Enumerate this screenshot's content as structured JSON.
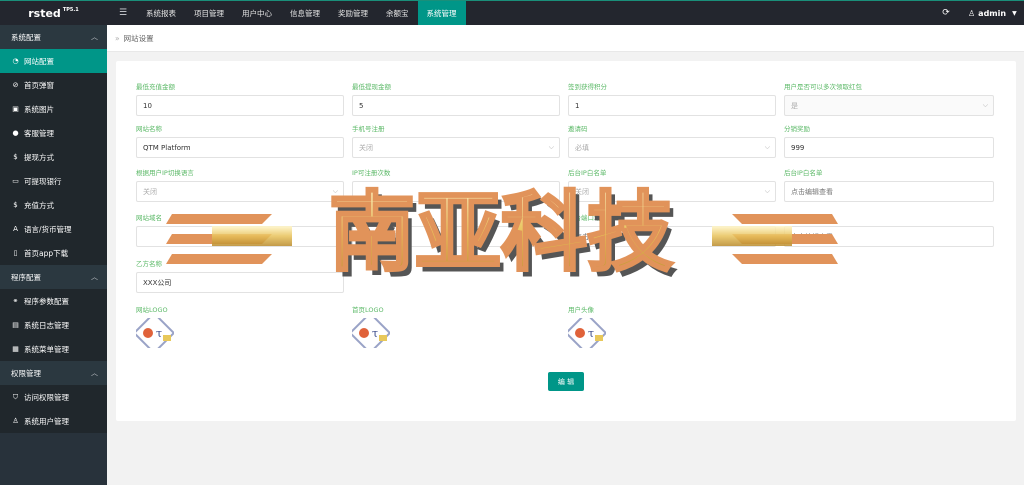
{
  "topbar": {
    "logo": "rsted",
    "logo_version": "TP5.1",
    "menu_icon": "☰",
    "nav": [
      "系统报表",
      "项目管理",
      "用户中心",
      "信息管理",
      "奖励管理",
      "余额宝",
      "系统管理"
    ],
    "active_nav": "系统管理",
    "user": "admin",
    "accent": "#009688"
  },
  "sidebar": {
    "groups": [
      {
        "label": "系统配置",
        "items": [
          {
            "label": "网站配置",
            "icon": "gauge-icon",
            "active": true
          },
          {
            "label": "首页弹窗",
            "icon": "link-icon"
          },
          {
            "label": "系统图片",
            "icon": "image-icon"
          },
          {
            "label": "客服管理",
            "icon": "chat-icon"
          },
          {
            "label": "提现方式",
            "icon": "dollar-icon"
          },
          {
            "label": "可提现银行",
            "icon": "card-icon"
          },
          {
            "label": "充值方式",
            "icon": "dollar-icon"
          },
          {
            "label": "语言/货币管理",
            "icon": "translate-icon"
          },
          {
            "label": "首页app下载",
            "icon": "mobile-icon"
          }
        ]
      },
      {
        "label": "程序配置",
        "items": [
          {
            "label": "程序参数配置",
            "icon": "link-icon"
          },
          {
            "label": "系统日志管理",
            "icon": "log-icon"
          },
          {
            "label": "系统菜单管理",
            "icon": "menu-icon"
          }
        ]
      },
      {
        "label": "权限管理",
        "items": [
          {
            "label": "访问权限管理",
            "icon": "shield-icon"
          },
          {
            "label": "系统用户管理",
            "icon": "user-icon"
          }
        ]
      }
    ]
  },
  "breadcrumb": "网站设置",
  "form": {
    "min_recharge": {
      "label": "最低充值金额",
      "value": "10"
    },
    "min_withdraw": {
      "label": "最低提现金额",
      "value": "5"
    },
    "signin_points": {
      "label": "签到获得积分",
      "value": "1"
    },
    "multi_redpacket": {
      "label": "用户是否可以多次领取红包",
      "value": "是"
    },
    "site_name": {
      "label": "网站名称",
      "value": "QTM Platform"
    },
    "phone_register": {
      "label": "手机号注册",
      "value": "关闭"
    },
    "invite_code": {
      "label": "邀请码",
      "value": "必填"
    },
    "share_link": {
      "label": "分销奖励",
      "value": "999"
    },
    "ip_language": {
      "label": "根据用户IP切换语言",
      "value": "关闭"
    },
    "ip_register_times": {
      "label": "IP可注册次数",
      "value": ""
    },
    "backend_ip_whitelist": {
      "label": "后台IP白名单",
      "value": "关闭"
    },
    "backend_ip_list": {
      "label": "后台IP白名单",
      "value": "点击编辑查看"
    },
    "site_domain": {
      "label": "网站域名",
      "value": ""
    },
    "backup_domain": {
      "label": "备用域名",
      "value": "点击编辑查看"
    },
    "backend_port_domain": {
      "label": "后台端口域名",
      "value": "点击编辑查看"
    },
    "backend_access_domain": {
      "label": "后台访问域名",
      "value": "点击编辑查看"
    },
    "party_b_name": {
      "label": "乙方名称",
      "value": "XXX公司"
    },
    "site_logo_label": "网站LOGO",
    "home_logo_label": "首页LOGO",
    "user_avatar_label": "用户头像",
    "edit_button": "编 辑"
  },
  "watermark": "南亚科技"
}
